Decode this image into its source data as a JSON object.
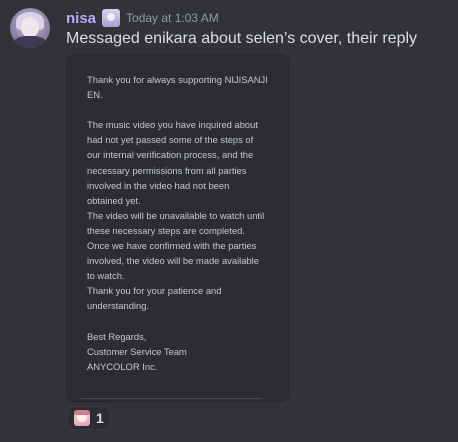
{
  "message": {
    "username": "nisa",
    "timestamp": "Today at 1:03 AM",
    "content": "Messaged enikara about selen’s cover, their reply",
    "colors": {
      "username": "#b7a7ff",
      "background": "#313338",
      "attachment_bg": "#2b2d31"
    },
    "avatar_icon": "user-avatar",
    "role_icon": "anime-girl-role-icon"
  },
  "attachment": {
    "lines": [
      "Thank you for always supporting NIJISANJI",
      "EN.",
      "",
      "The music video you have inquired about",
      "had not yet passed some of the steps of",
      "our internal verification process, and the",
      "necessary permissions from all parties",
      "involved in the video had not been",
      "obtained yet.",
      "The video will be unavailable to watch until",
      "these necessary steps are completed.",
      "Once we have confirmed with the parties",
      "involved, the video will be made available",
      "to watch.",
      "Thank you for your patience and",
      "understanding.",
      "",
      "Best Regards,",
      "Customer Service Team",
      "ANYCOLOR Inc."
    ]
  },
  "reaction": {
    "emoji_icon": "anime-girl-emoji",
    "count": "1"
  }
}
